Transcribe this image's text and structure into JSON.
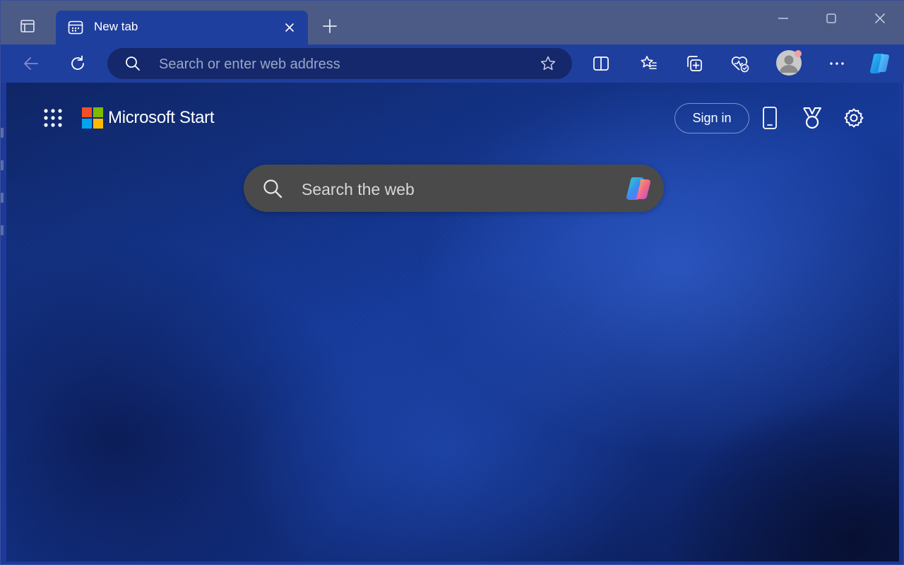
{
  "window": {
    "minimize_label": "",
    "maximize_label": "",
    "close_label": ""
  },
  "tabs": [
    {
      "title": "New tab",
      "icon": "new-tab-page-icon",
      "active": true
    }
  ],
  "toolbar": {
    "address_placeholder": "Search or enter web address",
    "icons": [
      "back-arrow-icon",
      "refresh-icon",
      "search-icon",
      "favorite-star-icon",
      "split-screen-icon",
      "favorites-icon",
      "collections-icon",
      "browser-essentials-icon",
      "profile-avatar",
      "more-options-icon",
      "copilot-icon"
    ]
  },
  "page": {
    "brand": "Microsoft Start",
    "sign_in": "Sign in",
    "search_placeholder": "Search the web",
    "icons": [
      "apps-grid-icon",
      "microsoft-logo",
      "phone-icon",
      "rewards-medal-icon",
      "settings-gear-icon",
      "copilot-icon"
    ]
  },
  "colors": {
    "titlebar": "#4b5b86",
    "toolbar": "#1f3f9e",
    "address_bar": "#15286b",
    "search_box": "#4a4a4a",
    "ms_red": "#f25022",
    "ms_green": "#7fba00",
    "ms_blue": "#00a4ef",
    "ms_yellow": "#ffb900"
  }
}
